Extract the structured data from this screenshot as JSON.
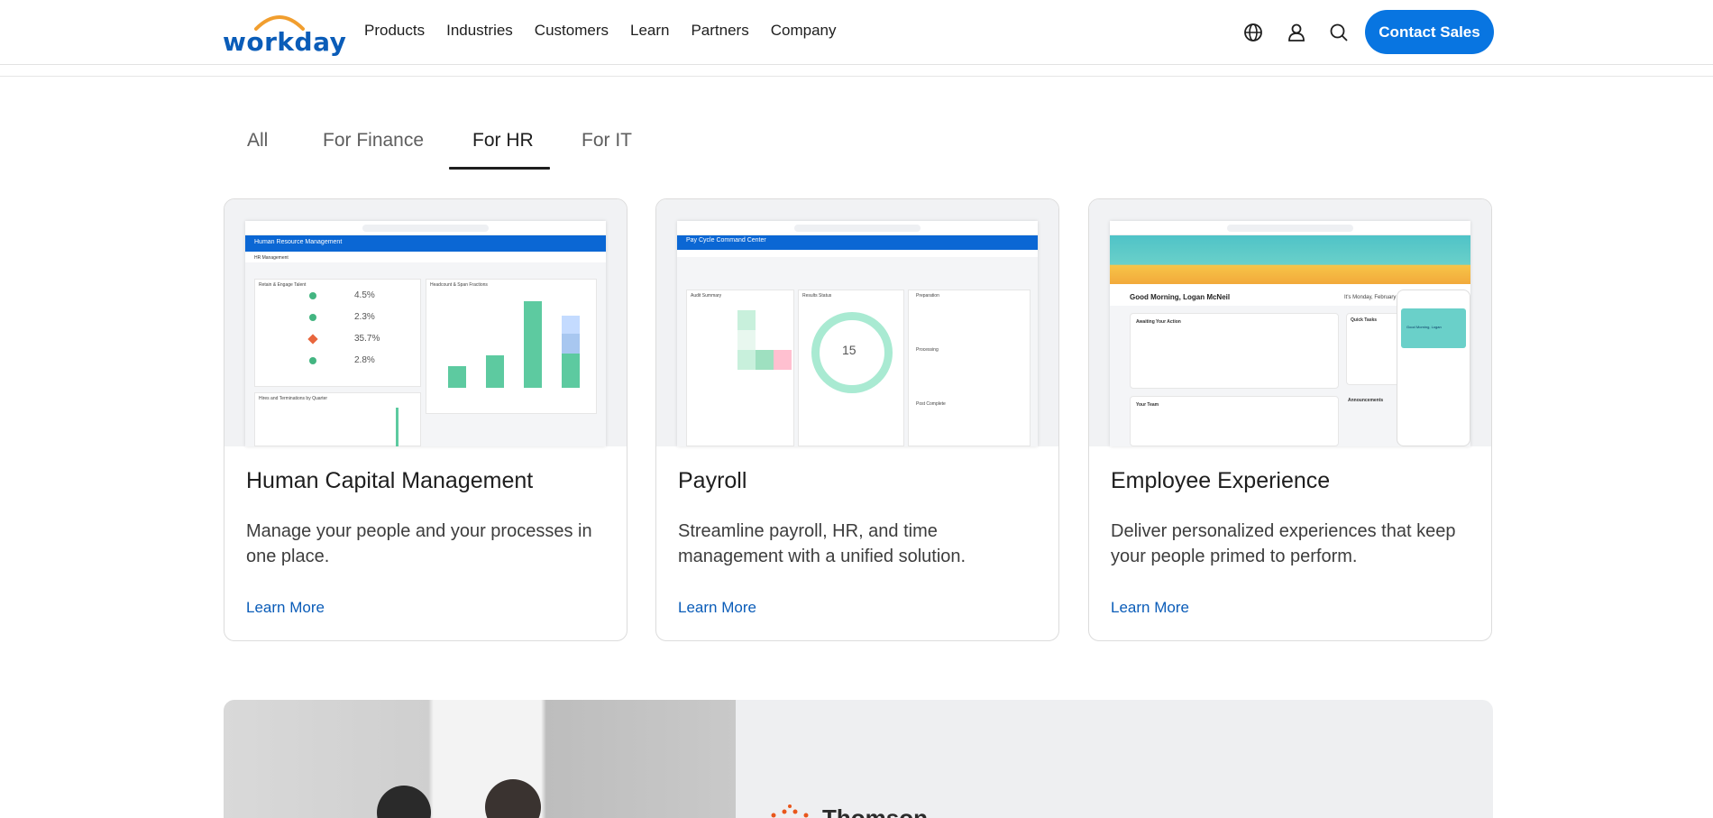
{
  "header": {
    "logo_text": "workday",
    "nav": [
      "Products",
      "Industries",
      "Customers",
      "Learn",
      "Partners",
      "Company"
    ],
    "icons": [
      "globe-icon",
      "user-icon",
      "search-icon"
    ],
    "contact_label": "Contact Sales",
    "accent": "#0875e1"
  },
  "tabs": [
    {
      "label": "All",
      "active": false
    },
    {
      "label": "For Finance",
      "active": false
    },
    {
      "label": "For HR",
      "active": true
    },
    {
      "label": "For IT",
      "active": false
    }
  ],
  "cards": [
    {
      "title": "Human Capital Management",
      "desc": "Manage your people and your processes in one place.",
      "link": "Learn More",
      "shot": {
        "bar_title": "Human Resource Management",
        "tab": "HR Management",
        "panel1": "Retain & Engage Talent",
        "panel2": "Headcount & Span Fractions",
        "panel3": "Hires and Terminations by Quarter",
        "metrics": [
          "4.5%",
          "2.3%",
          "35.7%",
          "2.8%"
        ]
      }
    },
    {
      "title": "Payroll",
      "desc": "Streamline payroll, HR, and time management with a unified solution.",
      "link": "Learn More",
      "shot": {
        "bar_title": "Pay Cycle Command Center",
        "panel1": "Audit Summary",
        "panel2": "Results Status",
        "count": "15",
        "list": [
          "Preparation",
          "Processing",
          "Post Complete"
        ]
      }
    },
    {
      "title": "Employee Experience",
      "desc": "Deliver personalized experiences that keep your people primed to perform.",
      "link": "Learn More",
      "shot": {
        "greeting": "Good Morning, Logan McNeil",
        "date": "It's Monday, February",
        "awaiting": "Awaiting Your Action",
        "team": "Your Team",
        "quick": "Quick Tasks",
        "announce": "Announcements",
        "phone_greeting": "Good Morning, Logan"
      }
    }
  ],
  "banner": {
    "brand": "Thomson"
  }
}
